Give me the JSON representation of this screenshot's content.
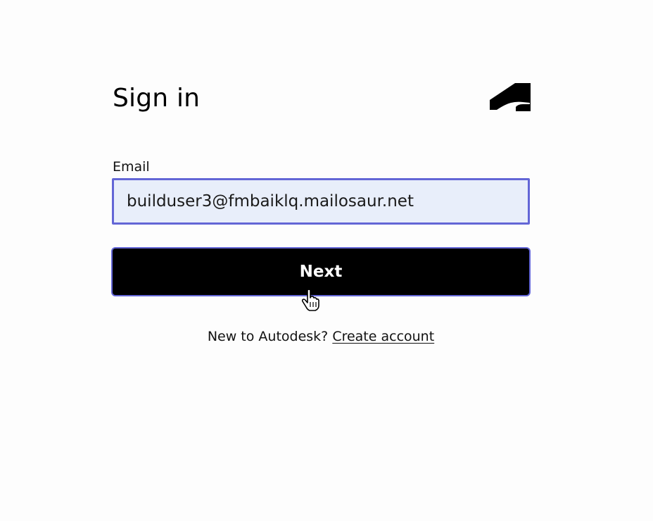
{
  "form": {
    "title": "Sign in",
    "logo_icon": "autodesk-logo",
    "email": {
      "label": "Email",
      "value": "builduser3@fmbaiklq.mailosaur.net",
      "focus_border_color": "#6366d6",
      "fill_color": "#e8eefa"
    },
    "next_button": {
      "label": "Next",
      "background": "#000000"
    },
    "signup": {
      "prompt": "New to Autodesk?",
      "link_label": "Create account"
    }
  },
  "cursor_icon": "hand-pointer-icon"
}
